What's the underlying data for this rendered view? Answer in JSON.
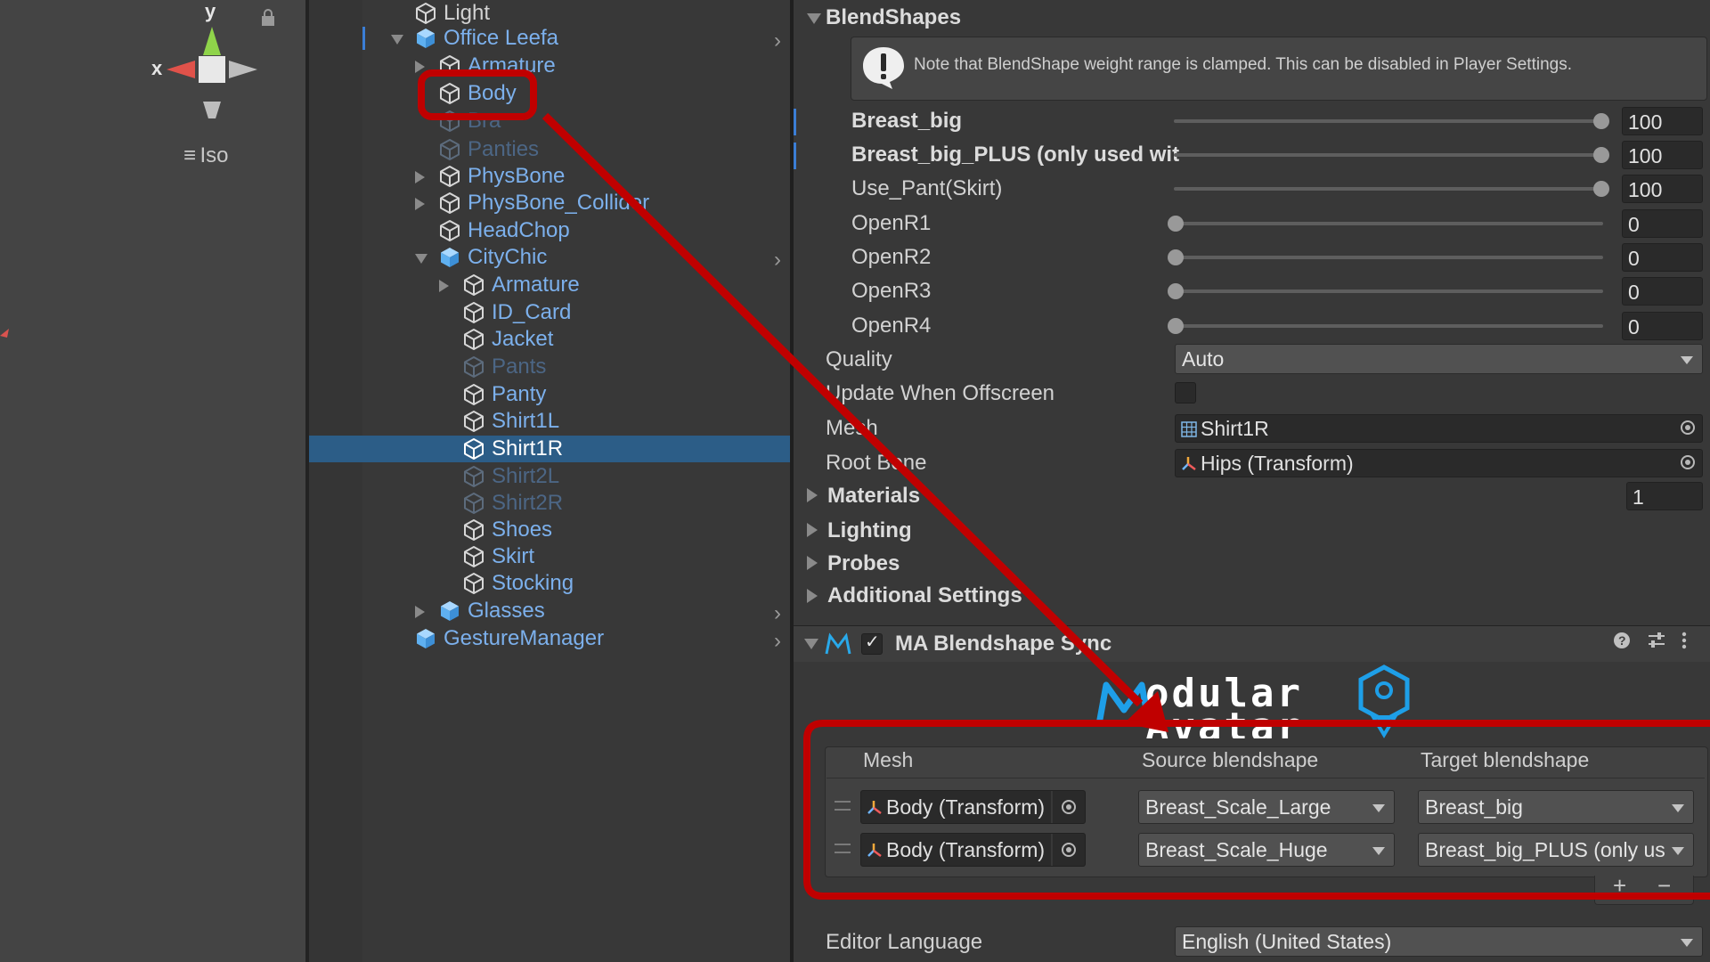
{
  "scene": {
    "axis_y": "y",
    "axis_x": "x",
    "projection_label": "Iso"
  },
  "hierarchy": {
    "rows": [
      {
        "label": "Light",
        "indent": 0,
        "icon": "gameobject-icon",
        "style": "normal",
        "fold": "",
        "chevron": false
      },
      {
        "label": "Office Leefa",
        "indent": 0,
        "icon": "prefab-icon",
        "style": "prefab",
        "fold": "down",
        "chevron": true
      },
      {
        "label": "Armature",
        "indent": 1,
        "icon": "gameobject-icon",
        "style": "prefab",
        "fold": "right",
        "chevron": false
      },
      {
        "label": "Body",
        "indent": 1,
        "icon": "gameobject-icon",
        "style": "prefab",
        "fold": "",
        "chevron": false
      },
      {
        "label": "Bra",
        "indent": 1,
        "icon": "gameobject-icon",
        "style": "dim",
        "fold": "",
        "chevron": false
      },
      {
        "label": "Panties",
        "indent": 1,
        "icon": "gameobject-icon",
        "style": "dim",
        "fold": "",
        "chevron": false
      },
      {
        "label": "PhysBone",
        "indent": 1,
        "icon": "gameobject-icon",
        "style": "prefab",
        "fold": "right",
        "chevron": false
      },
      {
        "label": "PhysBone_Collider",
        "indent": 1,
        "icon": "gameobject-icon",
        "style": "prefab",
        "fold": "right",
        "chevron": false
      },
      {
        "label": "HeadChop",
        "indent": 1,
        "icon": "gameobject-icon",
        "style": "prefab",
        "fold": "",
        "chevron": false
      },
      {
        "label": "CityChic",
        "indent": 1,
        "icon": "prefab-icon",
        "style": "prefab",
        "fold": "down",
        "chevron": true
      },
      {
        "label": "Armature",
        "indent": 2,
        "icon": "gameobject-icon",
        "style": "prefab",
        "fold": "right",
        "chevron": false
      },
      {
        "label": "ID_Card",
        "indent": 2,
        "icon": "gameobject-icon",
        "style": "prefab",
        "fold": "",
        "chevron": false
      },
      {
        "label": "Jacket",
        "indent": 2,
        "icon": "gameobject-icon",
        "style": "prefab",
        "fold": "",
        "chevron": false
      },
      {
        "label": "Pants",
        "indent": 2,
        "icon": "gameobject-icon",
        "style": "dim",
        "fold": "",
        "chevron": false
      },
      {
        "label": "Panty",
        "indent": 2,
        "icon": "gameobject-icon",
        "style": "prefab",
        "fold": "",
        "chevron": false
      },
      {
        "label": "Shirt1L",
        "indent": 2,
        "icon": "gameobject-icon",
        "style": "prefab",
        "fold": "",
        "chevron": false
      },
      {
        "label": "Shirt1R",
        "indent": 2,
        "icon": "gameobject-icon",
        "style": "selected",
        "fold": "",
        "chevron": false
      },
      {
        "label": "Shirt2L",
        "indent": 2,
        "icon": "gameobject-icon",
        "style": "dim",
        "fold": "",
        "chevron": false
      },
      {
        "label": "Shirt2R",
        "indent": 2,
        "icon": "gameobject-icon",
        "style": "dim",
        "fold": "",
        "chevron": false
      },
      {
        "label": "Shoes",
        "indent": 2,
        "icon": "gameobject-icon",
        "style": "prefab",
        "fold": "",
        "chevron": false
      },
      {
        "label": "Skirt",
        "indent": 2,
        "icon": "gameobject-icon",
        "style": "prefab",
        "fold": "",
        "chevron": false
      },
      {
        "label": "Stocking",
        "indent": 2,
        "icon": "gameobject-icon",
        "style": "prefab",
        "fold": "",
        "chevron": false
      },
      {
        "label": "Glasses",
        "indent": 1,
        "icon": "prefab-icon",
        "style": "prefab",
        "fold": "right",
        "chevron": true
      },
      {
        "label": "GestureManager",
        "indent": 0,
        "icon": "prefab-icon",
        "style": "prefab",
        "fold": "",
        "chevron": true
      }
    ]
  },
  "inspector": {
    "blendshapes_header": "BlendShapes",
    "blendshape_note": "Note that BlendShape weight range is clamped. This can be disabled in Player Settings.",
    "blendshapes": [
      {
        "name": "Breast_big",
        "value": "100",
        "weight": 1.0,
        "bold": true
      },
      {
        "name": "Breast_big_PLUS (only used wit",
        "value": "100",
        "weight": 1.0,
        "bold": true
      },
      {
        "name": "Use_Pant(Skirt)",
        "value": "100",
        "weight": 1.0,
        "bold": false
      },
      {
        "name": "OpenR1",
        "value": "0",
        "weight": 0.0,
        "bold": false
      },
      {
        "name": "OpenR2",
        "value": "0",
        "weight": 0.0,
        "bold": false
      },
      {
        "name": "OpenR3",
        "value": "0",
        "weight": 0.0,
        "bold": false
      },
      {
        "name": "OpenR4",
        "value": "0",
        "weight": 0.0,
        "bold": false
      }
    ],
    "quality_label": "Quality",
    "quality_value": "Auto",
    "update_offscreen_label": "Update When Offscreen",
    "mesh_label": "Mesh",
    "mesh_value": "Shirt1R",
    "root_bone_label": "Root Bone",
    "root_bone_value": "Hips (Transform)",
    "materials_label": "Materials",
    "materials_count": "1",
    "lighting_label": "Lighting",
    "probes_label": "Probes",
    "additional_settings_label": "Additional Settings",
    "component_title": "MA Blendshape Sync",
    "logo_text_top": "odular",
    "logo_text_bottom": "Avatar",
    "table_headers": {
      "mesh": "Mesh",
      "source": "Source blendshape",
      "target": "Target blendshape"
    },
    "table_rows": [
      {
        "mesh": "Body (Transform)",
        "source": "Breast_Scale_Large",
        "target": "Breast_big"
      },
      {
        "mesh": "Body (Transform)",
        "source": "Breast_Scale_Huge",
        "target": "Breast_big_PLUS (only us"
      }
    ],
    "add_symbol": "+",
    "remove_symbol": "−",
    "editor_language_label": "Editor Language",
    "editor_language_value": "English (United States)"
  },
  "colors": {
    "annotation_red": "#c00000",
    "prefab_blue": "#7cb0ec",
    "selection_blue": "#2c5d87"
  }
}
